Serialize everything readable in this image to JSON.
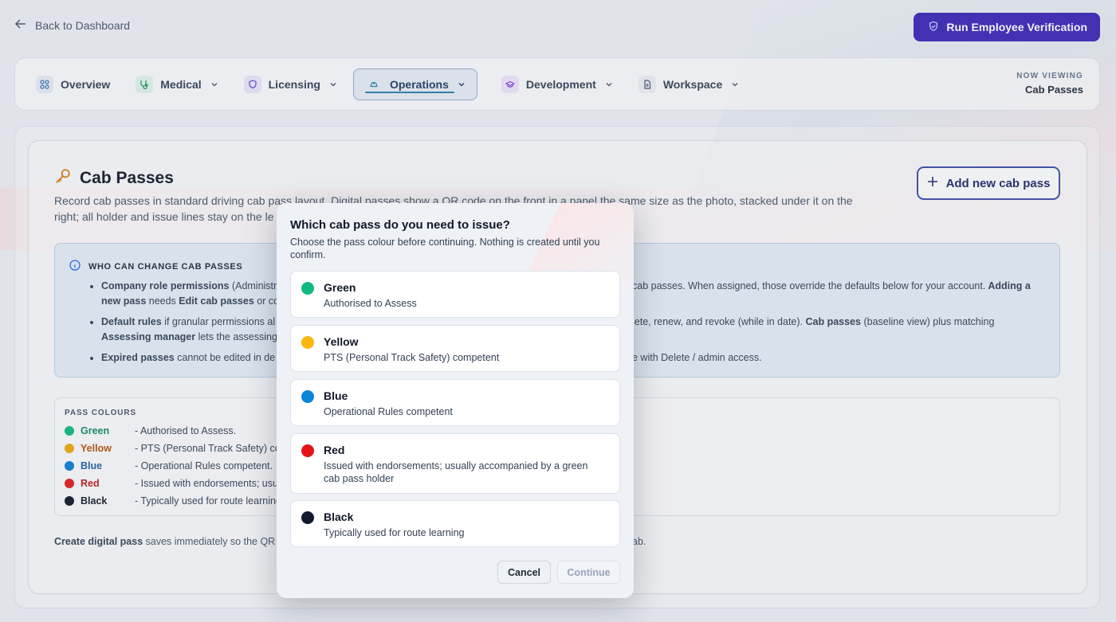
{
  "topbar": {
    "back_label": "Back to Dashboard",
    "verify_label": "Run Employee Verification"
  },
  "nav": {
    "items": [
      {
        "label": "Overview",
        "icon": "grid-icon"
      },
      {
        "label": "Medical",
        "icon": "stethoscope-icon"
      },
      {
        "label": "Licensing",
        "icon": "shield-icon"
      },
      {
        "label": "Operations",
        "icon": "helmet-icon"
      },
      {
        "label": "Development",
        "icon": "graduation-cap-icon"
      },
      {
        "label": "Workspace",
        "icon": "document-icon"
      }
    ],
    "now_viewing_label": "NOW VIEWING",
    "now_viewing_value": "Cab Passes"
  },
  "page": {
    "title": "Cab Passes",
    "description_visible_1": "Record cab passes in standard driving cab pass layout. Digital passes show a QR code on the front in a panel the same size as the photo, stacked under it on the",
    "description_visible_2": "right; all holder and issue lines stay on the le",
    "add_label": "Add new cab pass"
  },
  "info": {
    "heading": "WHO CAN CHANGE CAB PASSES",
    "b1_strong": "Company role permissions",
    "b1_left": " (Administra",
    "b1_right": "cab passes. When assigned, those override the defaults below for your account.",
    "b1_right_strong": " Adding a",
    "b1_line2_strong": "new pass",
    "b1_line2_mid": " needs ",
    "b1_line2_strong2": "Edit cab passes",
    "b1_line2_rest": " or co",
    "b2_strong": "Default rules",
    "b2_left": " if granular permissions al",
    "b2_right": "lete, renew, and revoke (while in date).",
    "b2_right_strong": " Cab passes",
    "b2_right_rest": " (baseline view) plus matching",
    "b2_line2_strong": "Assessing manager",
    "b2_line2_rest": " lets the assessing",
    "b3_strong": "Expired passes",
    "b3_left": " cannot be edited in de",
    "b3_right": "e with Delete / admin access."
  },
  "colours": {
    "heading": "PASS COLOURS",
    "rows": [
      {
        "name": "Green",
        "desc": "- Authorised to Assess.",
        "color": "#10b981",
        "text_color": "#0f8a5f"
      },
      {
        "name": "Yellow",
        "desc": "- PTS (Personal Track Safety) com",
        "color": "#f1a80a",
        "text_color": "#b45309"
      },
      {
        "name": "Blue",
        "desc": "- Operational Rules competent.",
        "color": "#0a7fd4",
        "text_color": "#1d5fa8"
      },
      {
        "name": "Red",
        "desc": "- Issued with endorsements; usua",
        "color": "#e11d1d",
        "text_color": "#b91c1c"
      },
      {
        "name": "Black",
        "desc": "- Typically used for route learning",
        "color": "#111827",
        "text_color": "#111827"
      }
    ]
  },
  "footnote": {
    "strong": "Create digital pass",
    "left": " saves immediately so the QR",
    "right": "ab."
  },
  "modal": {
    "title": "Which cab pass do you need to issue?",
    "subtitle": "Choose the pass colour before continuing. Nothing is created until you confirm.",
    "options": [
      {
        "title": "Green",
        "desc": "Authorised to Assess",
        "color": "#10b981"
      },
      {
        "title": "Yellow",
        "desc": "PTS (Personal Track Safety) competent",
        "color": "#fbb70d"
      },
      {
        "title": "Blue",
        "desc": "Operational Rules competent",
        "color": "#0a84d6"
      },
      {
        "title": "Red",
        "desc": "Issued with endorsements; usually accompanied by a green cab pass holder",
        "color": "#e5141b"
      },
      {
        "title": "Black",
        "desc": "Typically used for route learning",
        "color": "#141a2e"
      }
    ],
    "cancel_label": "Cancel",
    "continue_label": "Continue"
  }
}
